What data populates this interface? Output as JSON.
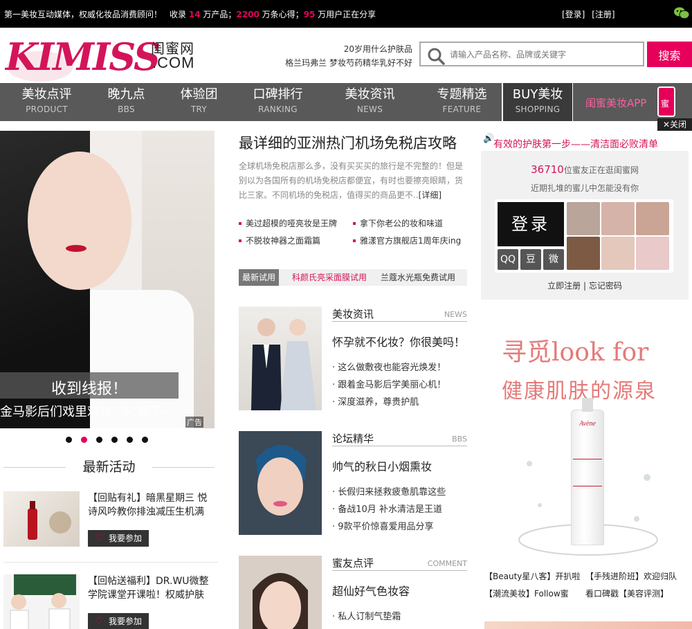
{
  "topbar": {
    "tagline": "第一美妆互动媒体，权威化妆品消费顾问！",
    "stats_prefix": "收录",
    "products_count": "14",
    "products_unit": "万产品；",
    "reviews_count": "2200",
    "reviews_unit": "万条心得；",
    "users_count": "95",
    "users_unit": "万用户正在分享",
    "login": "[登录]",
    "register": "[注册]"
  },
  "header": {
    "logo_en": "KIMISS",
    "logo_cn": "闺蜜网",
    "logo_com": ".COM",
    "hot_queries": [
      "20岁用什么护肤品",
      "格兰玛弗兰   梦妆芍药精华乳好不好"
    ],
    "search_placeholder": "请输入产品名称、品牌或关键字",
    "search_button": "搜索"
  },
  "nav": {
    "items": [
      {
        "zh": "美妆点评",
        "en": "PRODUCT"
      },
      {
        "zh": "晚九点",
        "en": "BBS"
      },
      {
        "zh": "体验团",
        "en": "TRY"
      },
      {
        "zh": "口碑排行",
        "en": "RANKING"
      },
      {
        "zh": "美妆资讯",
        "en": "NEWS"
      },
      {
        "zh": "专题精选",
        "en": "FEATURE"
      },
      {
        "zh": "BUY美妆",
        "en": "SHOPPING"
      }
    ],
    "app_label": "闺蜜美妆APP",
    "app_icon_char": "蜜",
    "close_ad": "✕关闭"
  },
  "hero": {
    "caption": "收到线报！",
    "subcaption": "金马影后们戏里戏外“斗”疯了~",
    "ad_tag": "广告",
    "slide_count": 6,
    "active_slide": 2
  },
  "activities": {
    "title": "最新活动",
    "items": [
      {
        "text": "【回贴有礼】暗黑星期三 悦诗风吟教你排浊减压生机满",
        "join": "我要参加"
      },
      {
        "text": "【回帖送福利】DR.WU微整学院课堂开课啦！权威护肤",
        "join": "我要参加"
      }
    ]
  },
  "feature": {
    "headline": "最详细的亚洲热门机场免税店攻略",
    "summary": "全球机场免税店那么多，没有买买买的旅行是不完整的！但是别以为各国所有的机场免税店都便宜，有时也要擦亮眼睛，货比三家。不同机场的免税店，值得买的商品更不..",
    "more": "[详细]",
    "bullets": [
      "美过超模的哑亮妆是王牌",
      "拿下你老公的妆和味道",
      "不脱妆神器之面霜篇",
      "雅漾官方旗舰店1周年庆ing"
    ]
  },
  "trial": {
    "label": "最新试用",
    "items": [
      "科颜氏亮采面膜试用",
      "兰蔻水光瓶免费试用"
    ]
  },
  "news_blocks": [
    {
      "cat": "美妆资讯",
      "en": "NEWS",
      "title": "怀孕就不化妆？你很美吗！",
      "items": [
        "· 这么做敷夜也能容光焕发！",
        "· 跟着金马影后学美丽心机！",
        "· 深度滋养，尊贵护肌"
      ]
    },
    {
      "cat": "论坛精华",
      "en": "BBS",
      "title": "帅气的秋日小烟熏妆",
      "items": [
        "· 长假归来拯救疲惫肌靠这些",
        "· 备战10月 补水清洁是王道",
        "· 9款平价惊喜爱用品分享"
      ]
    },
    {
      "cat": "蜜友点评",
      "en": "COMMENT",
      "title": "超仙好气色妆容",
      "items": [
        "· 私人订制气垫霜"
      ]
    }
  ],
  "sidebar": {
    "speaker_icon": "🔊",
    "scroll_text": "有效的护肤第一步——清洁面必败清单",
    "online_count": "36710",
    "online_suffix": "位蜜友正在逛闺蜜网",
    "online_sub": "近期扎堆的蜜儿中怎能没有你",
    "login_button": "登录",
    "social": [
      "QQ",
      "豆",
      "微"
    ],
    "register_link": "立即注册",
    "forgot_link": "忘记密码",
    "divider": "|"
  },
  "side_ad": {
    "line1": "寻觅look for",
    "line2": "健康肌肤的源泉",
    "bottle_brand": "Avène"
  },
  "side_links": [
    "【Beauty星八客】开扒啦",
    "【手残进阶班】欢迎归队",
    "【潮流美妆】Follow蜜",
    "看口碑戳【美容评测】"
  ],
  "colors": {
    "accent": "#e6005c",
    "nav_bg": "#595959",
    "topbar_bg": "#000000"
  }
}
